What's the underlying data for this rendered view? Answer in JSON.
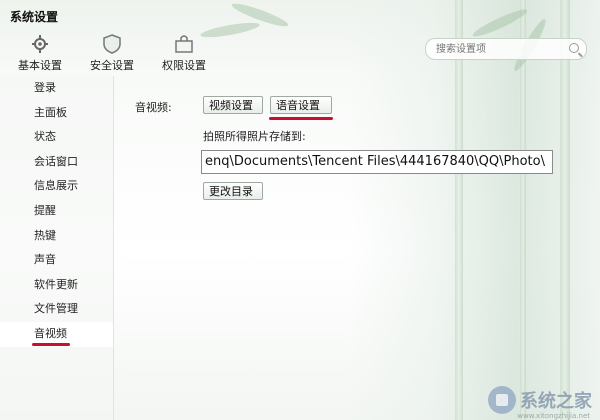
{
  "app": {
    "title": "系统设置"
  },
  "nav": {
    "tabs": [
      {
        "label": "基本设置",
        "icon": "gear-icon"
      },
      {
        "label": "安全设置",
        "icon": "shield-icon"
      },
      {
        "label": "权限设置",
        "icon": "lock-folder-icon"
      }
    ]
  },
  "search": {
    "placeholder": "搜索设置项"
  },
  "sidebar": {
    "items": [
      {
        "label": "登录"
      },
      {
        "label": "主面板"
      },
      {
        "label": "状态"
      },
      {
        "label": "会话窗口"
      },
      {
        "label": "信息展示"
      },
      {
        "label": "提醒"
      },
      {
        "label": "热键"
      },
      {
        "label": "声音"
      },
      {
        "label": "软件更新"
      },
      {
        "label": "文件管理"
      },
      {
        "label": "音视频",
        "active": true
      }
    ]
  },
  "main": {
    "section_label": "音视频:",
    "video_settings_label": "视频设置",
    "voice_settings_label": "语音设置",
    "photo_store_label": "拍照所得照片存储到:",
    "photo_path": "enq\\Documents\\Tencent Files\\444167840\\QQ\\Photo\\",
    "change_dir_label": "更改目录"
  },
  "watermark": {
    "text": "系统之家",
    "url": "www.xitongzhijia.net"
  },
  "colors": {
    "accent_underline": "#c8102e"
  }
}
